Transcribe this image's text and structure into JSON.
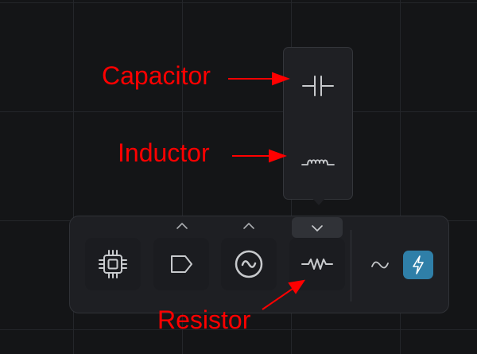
{
  "annotations": {
    "capacitor": "Capacitor",
    "inductor": "Inductor",
    "resistor": "Resistor"
  },
  "popup": {
    "items": [
      {
        "name": "capacitor",
        "icon": "capacitor-icon"
      },
      {
        "name": "inductor",
        "icon": "inductor-icon"
      }
    ]
  },
  "toolbar": {
    "tools": [
      {
        "name": "chip",
        "icon": "chip-icon",
        "has_caret": false
      },
      {
        "name": "label-tag",
        "icon": "tag-icon",
        "has_caret": true
      },
      {
        "name": "ac-source",
        "icon": "ac-source-icon",
        "has_caret": true
      },
      {
        "name": "resistor",
        "icon": "resistor-icon",
        "has_caret": true,
        "caret_open": true
      }
    ],
    "secondary": [
      {
        "name": "waveform",
        "icon": "sine-wave-icon",
        "active": false
      },
      {
        "name": "power",
        "icon": "lightning-icon",
        "active": true
      }
    ]
  },
  "colors": {
    "background": "#141517",
    "panel": "#1e1f23",
    "icon": "#c8cacd",
    "accent": "#2f7fa8",
    "annotation": "#ff0000"
  }
}
